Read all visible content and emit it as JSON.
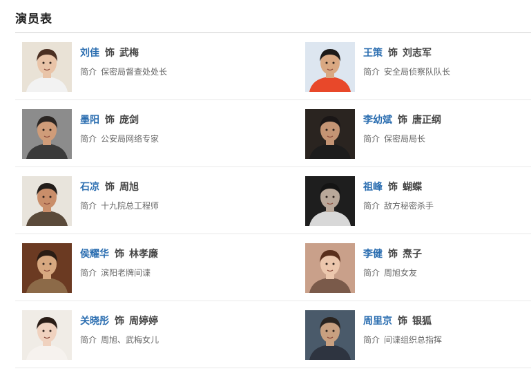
{
  "section_title": "演员表",
  "as_word": "饰",
  "intro_label": "简介",
  "cast": [
    {
      "actor": "刘佳",
      "role": "武梅",
      "intro": "保密局督查处处长",
      "bg": "#e9e2d6",
      "skin": "#e9c4a8",
      "hair": "#4a2f22",
      "clothes": "#f2f2f2"
    },
    {
      "actor": "王策",
      "role": "刘志军",
      "intro": "安全局侦察队队长",
      "bg": "#dde6f0",
      "skin": "#d9a882",
      "hair": "#1d1a18",
      "clothes": "#e8482a"
    },
    {
      "actor": "墨阳",
      "role": "庞剑",
      "intro": "公安局网络专家",
      "bg": "#8c8c8c",
      "skin": "#cf9c79",
      "hair": "#2a2522",
      "clothes": "#3a3a3a"
    },
    {
      "actor": "李幼斌",
      "role": "唐正纲",
      "intro": "保密局局长",
      "bg": "#2a2420",
      "skin": "#c49474",
      "hair": "#1a1616",
      "clothes": "#1c1c1c"
    },
    {
      "actor": "石凉",
      "role": "周旭",
      "intro": "十九院总工程师",
      "bg": "#e8e4dc",
      "skin": "#c98e6a",
      "hair": "#221d1a",
      "clothes": "#5a4a3a"
    },
    {
      "actor": "祖峰",
      "role": "蝴蝶",
      "intro": "敌方秘密杀手",
      "bg": "#1e1e1e",
      "skin": "#b9a89a",
      "hair": "#141414",
      "clothes": "#d8d8d8"
    },
    {
      "actor": "侯耀华",
      "role": "林孝廉",
      "intro": "滨阳老牌间谍",
      "bg": "#6b3a22",
      "skin": "#d7a880",
      "hair": "#2a1c14",
      "clothes": "#8c6a48"
    },
    {
      "actor": "李健",
      "role": "焘子",
      "intro": "周旭女友",
      "bg": "#c9a08a",
      "skin": "#ecc7ad",
      "hair": "#5a2f1c",
      "clothes": "#7a5a4a"
    },
    {
      "actor": "关晓彤",
      "role": "周婷婷",
      "intro": "周旭、武梅女儿",
      "bg": "#f0ece6",
      "skin": "#f0d2bf",
      "hair": "#2a1d16",
      "clothes": "#f6f2ee"
    },
    {
      "actor": "周里京",
      "role": "银狐",
      "intro": "间谍组织总指挥",
      "bg": "#4a5a6a",
      "skin": "#c9a080",
      "hair": "#2a2420",
      "clothes": "#2e3440"
    }
  ]
}
